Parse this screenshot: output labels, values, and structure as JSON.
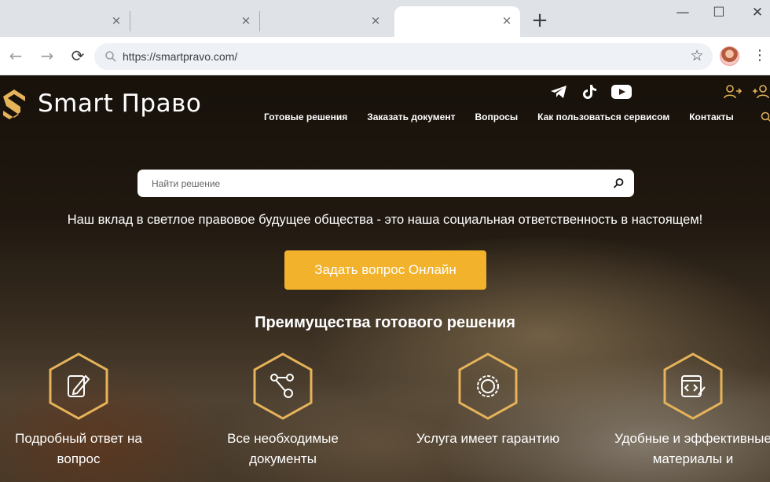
{
  "browser": {
    "tabs": [
      {
        "title": "",
        "active": false
      },
      {
        "title": "",
        "active": false
      },
      {
        "title": "",
        "active": false
      },
      {
        "title": "",
        "active": true
      }
    ],
    "close_glyph": "×",
    "new_tab_glyph": "+",
    "window_controls": {
      "minimize": "—",
      "maximize": "☐",
      "close": "✕"
    },
    "back_glyph": "←",
    "forward_glyph": "→",
    "reload_glyph": "⟳",
    "url": "https://smartpravo.com/",
    "bookmark_glyph": "☆",
    "menu_glyph": "⋮"
  },
  "site": {
    "brand": "Smart Право",
    "accent_color": "#f2b22c",
    "socials": [
      "telegram-icon",
      "tiktok-icon",
      "youtube-icon"
    ],
    "nav": [
      "Готовые решения",
      "Заказать документ",
      "Вопросы",
      "Как пользоваться сервисом",
      "Контакты"
    ],
    "search_placeholder": "Найти решение",
    "tagline": "Наш вклад в светлое правовое будущее общества - это наша социальная ответственность в настоящем!",
    "cta": "Задать вопрос Онлайн",
    "section_title": "Преимущества готового решения",
    "features": [
      {
        "icon": "edit-document-icon",
        "label": "Подробный ответ на вопрос"
      },
      {
        "icon": "network-nodes-icon",
        "label": "Все необходимые документы"
      },
      {
        "icon": "guarantee-badge-icon",
        "label": "Услуга имеет гарантию"
      },
      {
        "icon": "code-document-icon",
        "label": "Удобные и эффективные материалы и"
      }
    ]
  }
}
